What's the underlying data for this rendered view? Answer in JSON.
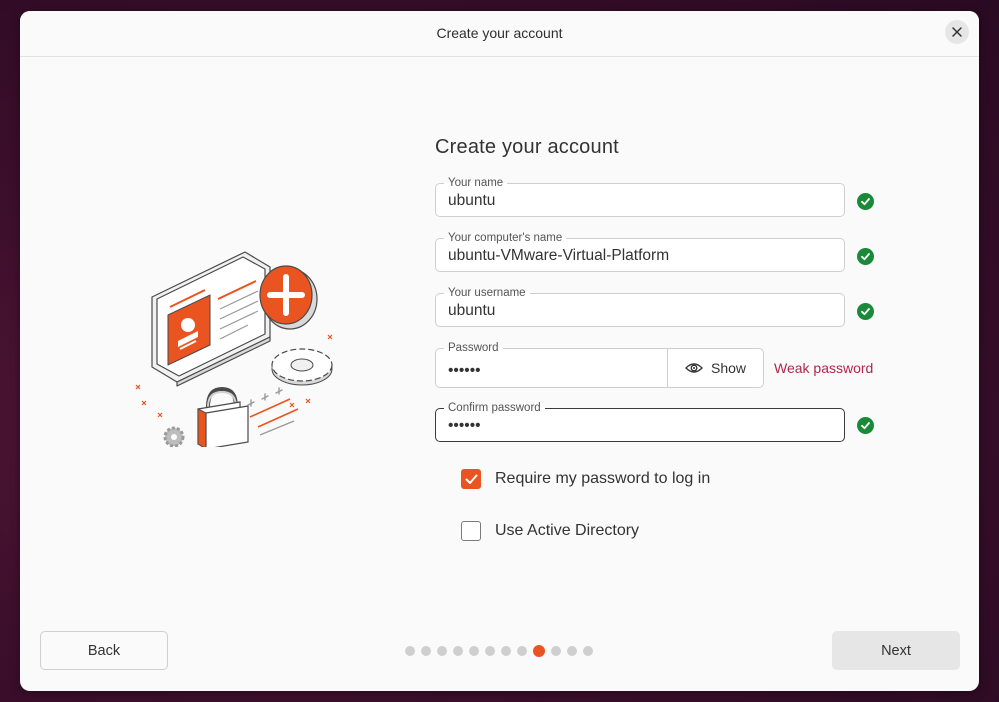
{
  "window": {
    "title": "Create your account"
  },
  "form": {
    "heading": "Create your account",
    "fields": {
      "name": {
        "label": "Your name",
        "value": "ubuntu",
        "valid": true
      },
      "computer": {
        "label": "Your computer's name",
        "value": "ubuntu-VMware-Virtual-Platform",
        "valid": true
      },
      "username": {
        "label": "Your username",
        "value": "ubuntu",
        "valid": true
      },
      "password": {
        "label": "Password",
        "value": "••••••",
        "show_label": "Show",
        "strength": "Weak password"
      },
      "confirm": {
        "label": "Confirm password",
        "value": "••••••",
        "valid": true
      }
    },
    "options": {
      "require_password": {
        "label": "Require my password to log in",
        "checked": true
      },
      "active_directory": {
        "label": "Use Active Directory",
        "checked": false
      }
    }
  },
  "nav": {
    "back_label": "Back",
    "next_label": "Next",
    "steps_total": 12,
    "current_step": 9
  },
  "colors": {
    "accent": "#e95420",
    "valid": "#1a8a3a",
    "weak": "#b0264d"
  }
}
